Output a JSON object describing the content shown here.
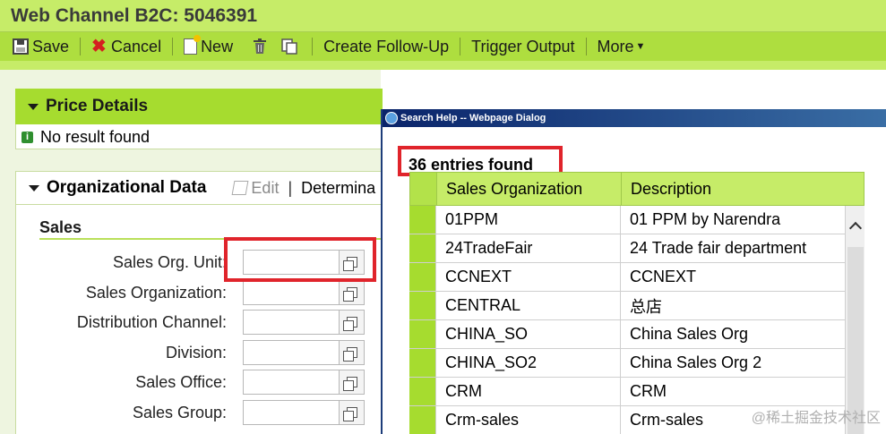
{
  "window": {
    "title": "Web Channel B2C: 5046391"
  },
  "toolbar": {
    "save": "Save",
    "cancel": "Cancel",
    "new": "New",
    "create_follow_up": "Create Follow-Up",
    "trigger_output": "Trigger Output",
    "more": "More"
  },
  "price_details": {
    "title": "Price Details",
    "message": "No result found"
  },
  "org_data": {
    "title": "Organizational Data",
    "edit": "Edit",
    "determine": "Determina",
    "sales_section": "Sales",
    "fields": [
      {
        "label": "Sales Org. Unit:",
        "value": ""
      },
      {
        "label": "Sales Organization:",
        "value": ""
      },
      {
        "label": "Distribution Channel:",
        "value": ""
      },
      {
        "label": "Division:",
        "value": ""
      },
      {
        "label": "Sales Office:",
        "value": ""
      },
      {
        "label": "Sales Group:",
        "value": ""
      }
    ]
  },
  "dialog": {
    "title": "Search Help -- Webpage Dialog",
    "entries_found": "36 entries found",
    "columns": [
      "Sales Organization",
      "Description"
    ],
    "rows": [
      [
        "01PPM",
        "01 PPM by Narendra"
      ],
      [
        "24TradeFair",
        "24 Trade fair department"
      ],
      [
        "CCNEXT",
        "CCNEXT"
      ],
      [
        "CENTRAL",
        "总店"
      ],
      [
        "CHINA_SO",
        "China Sales Org"
      ],
      [
        "CHINA_SO2",
        "China Sales Org 2"
      ],
      [
        "CRM",
        "CRM"
      ],
      [
        "Crm-sales",
        "Crm-sales"
      ]
    ]
  },
  "watermark": "@稀土掘金技术社区",
  "colors": {
    "accent_green": "#a6dc2f",
    "highlight_red": "#e0242b",
    "dialog_title": "#0a246a"
  }
}
